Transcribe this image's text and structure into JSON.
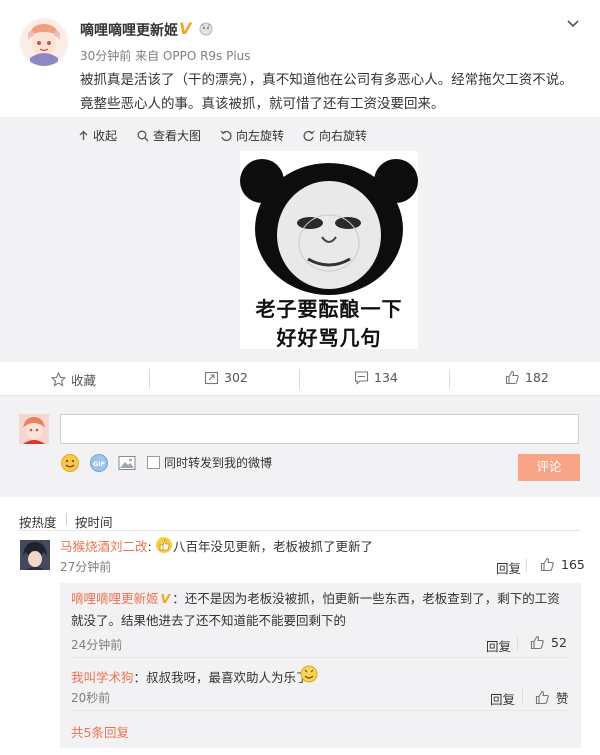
{
  "post": {
    "username": "嘀哩嘀哩更新姬",
    "verified_mark": "V",
    "time_source": "30分钟前 来自 OPPO R9s Plus",
    "text": "被抓真是活该了（干的漂亮），真不知道他在公司有多恶心人。经常拖欠工资不说。竟整些恶心人的事。真该被抓，就可惜了还有工资没要回来。"
  },
  "media_toolbar": {
    "collapse": "收起",
    "view_large": "查看大图",
    "rotate_left": "向左旋转",
    "rotate_right": "向右旋转"
  },
  "meme": {
    "line1": "老子要酝酿一下",
    "line2": "好好骂几句"
  },
  "actions": {
    "favorite": "收藏",
    "repost_count": "302",
    "comment_count": "134",
    "like_count": "182"
  },
  "composer": {
    "input_value": "",
    "forward_label": "同时转发到我的微博",
    "submit_label": "评论",
    "gif_label": "GIF"
  },
  "sort": {
    "by_hot": "按热度",
    "by_time": "按时间"
  },
  "comment": {
    "name": "马猴烧酒刘二改",
    "colon": ":",
    "text": "八百年没见更新，老板被抓了更新了",
    "time": "27分钟前",
    "reply_label": "回复",
    "likes": "165"
  },
  "replies": [
    {
      "name": "嘀哩嘀哩更新姬",
      "verified_mark": "V",
      "text": "：还不是因为老板没被抓，怕更新一些东西，老板查到了，剩下的工资就没了。结果他进去了还不知道能不能要回剩下的",
      "time": "24分钟前",
      "reply_label": "回复",
      "likes": "52"
    },
    {
      "name": "我叫学术狗",
      "text": "：叔叔我呀，最喜欢助人为乐了",
      "time": "20秒前",
      "reply_label": "回复",
      "likes": "赞"
    }
  ],
  "more_replies": "共5条回复",
  "colors": {
    "accent": "#eb7350",
    "link_blue": "#1a7cc2",
    "panel_bg": "#f2f2f5",
    "submit_bg": "#f8a587",
    "verified": "#f3a623"
  }
}
